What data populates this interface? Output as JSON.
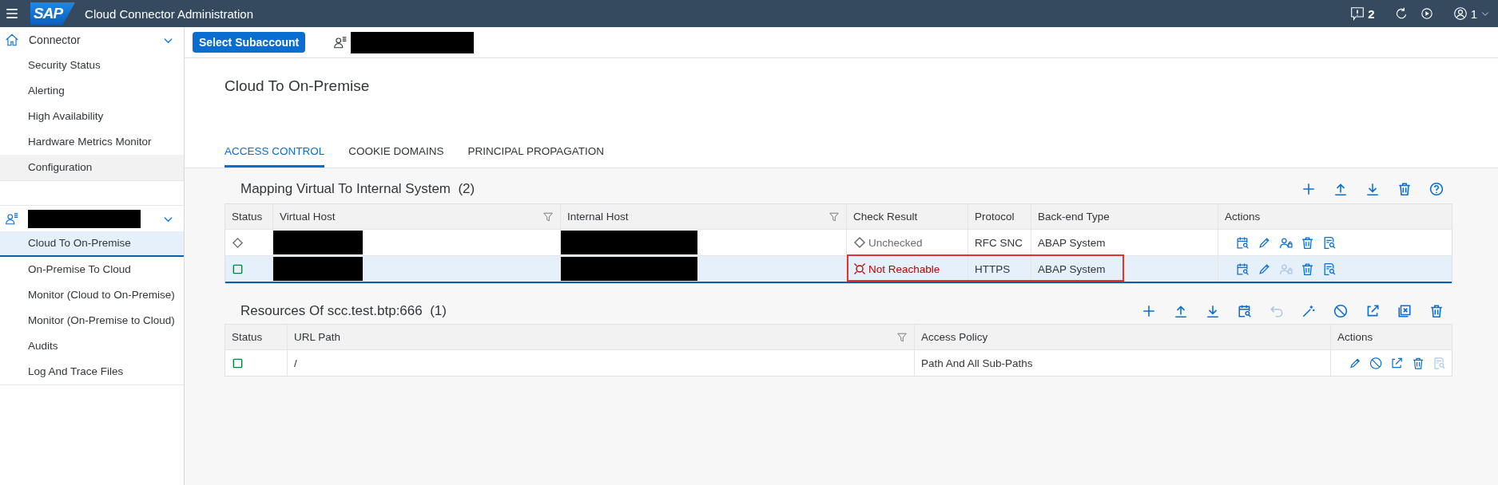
{
  "shell": {
    "logo_text": "SAP",
    "title": "Cloud Connector Administration",
    "notification_count": "2",
    "user_count": "1"
  },
  "sidebar": {
    "groups": [
      {
        "kind": "connector",
        "label": "Connector",
        "expanded": true,
        "items": [
          {
            "label": "Security Status",
            "selected": false,
            "hovered": false
          },
          {
            "label": "Alerting",
            "selected": false,
            "hovered": false
          },
          {
            "label": "High Availability",
            "selected": false,
            "hovered": false
          },
          {
            "label": "Hardware Metrics Monitor",
            "selected": false,
            "hovered": false
          },
          {
            "label": "Configuration",
            "selected": false,
            "hovered": true
          }
        ]
      },
      {
        "kind": "subaccount",
        "expanded": true,
        "items": [
          {
            "label": "Cloud To On-Premise",
            "selected": true,
            "hovered": false
          },
          {
            "label": "On-Premise To Cloud",
            "selected": false,
            "hovered": false
          },
          {
            "label": "Monitor (Cloud to On-Premise)",
            "selected": false,
            "hovered": false
          },
          {
            "label": "Monitor (On-Premise to Cloud)",
            "selected": false,
            "hovered": false
          },
          {
            "label": "Audits",
            "selected": false,
            "hovered": false
          },
          {
            "label": "Log And Trace Files",
            "selected": false,
            "hovered": false
          }
        ]
      }
    ]
  },
  "subheader": {
    "button": "Select Subaccount"
  },
  "page": {
    "title": "Cloud To On-Premise"
  },
  "tabs": [
    {
      "label": "ACCESS CONTROL",
      "selected": true
    },
    {
      "label": "COOKIE DOMAINS",
      "selected": false
    },
    {
      "label": "PRINCIPAL PROPAGATION",
      "selected": false
    }
  ],
  "mapping_table": {
    "title": "Mapping Virtual To Internal System",
    "count": "(2)",
    "toolbar": [
      {
        "kind": "add",
        "disabled": false
      },
      {
        "kind": "upload",
        "disabled": false
      },
      {
        "kind": "download",
        "disabled": false
      },
      {
        "kind": "delete",
        "disabled": false
      },
      {
        "kind": "help",
        "disabled": false
      }
    ],
    "columns": [
      {
        "label": "Status",
        "filter": false
      },
      {
        "label": "Virtual Host",
        "filter": true
      },
      {
        "label": "Internal Host",
        "filter": true
      },
      {
        "label": "Check Result",
        "filter": false
      },
      {
        "label": "Protocol",
        "filter": false
      },
      {
        "label": "Back-end Type",
        "filter": false
      },
      {
        "label": "Actions",
        "filter": false
      }
    ],
    "rows": [
      {
        "status_icon": {
          "kind": "unchecked"
        },
        "selected": false,
        "highlighted": false,
        "check_result": {
          "kind": "unchecked",
          "text": "Unchecked"
        },
        "protocol": "RFC SNC",
        "backend_type": "ABAP System",
        "actions": [
          {
            "kind": "check",
            "disabled": false
          },
          {
            "kind": "edit",
            "disabled": false
          },
          {
            "kind": "principal",
            "disabled": false
          },
          {
            "kind": "delete",
            "disabled": false
          },
          {
            "kind": "logs",
            "disabled": false
          }
        ]
      },
      {
        "status_icon": {
          "kind": "ok"
        },
        "selected": true,
        "highlighted": true,
        "check_result": {
          "kind": "unreachable",
          "text": "Not Reachable"
        },
        "protocol": "HTTPS",
        "backend_type": "ABAP System",
        "actions": [
          {
            "kind": "check",
            "disabled": false
          },
          {
            "kind": "edit",
            "disabled": false
          },
          {
            "kind": "principal",
            "disabled": true
          },
          {
            "kind": "delete",
            "disabled": false
          },
          {
            "kind": "logs",
            "disabled": false
          }
        ]
      }
    ]
  },
  "resources_table": {
    "title": "Resources Of scc.test.btp:666",
    "count": "(1)",
    "toolbar": [
      {
        "kind": "add",
        "disabled": false
      },
      {
        "kind": "upload",
        "disabled": false
      },
      {
        "kind": "download",
        "disabled": false
      },
      {
        "kind": "check",
        "disabled": false
      },
      {
        "kind": "undo",
        "disabled": true
      },
      {
        "kind": "wand",
        "disabled": false
      },
      {
        "kind": "block",
        "disabled": false
      },
      {
        "kind": "open",
        "disabled": false
      },
      {
        "kind": "close",
        "disabled": false
      },
      {
        "kind": "delete",
        "disabled": false
      }
    ],
    "columns": [
      {
        "label": "Status",
        "filter": false
      },
      {
        "label": "URL Path",
        "filter": true
      },
      {
        "label": "Access Policy",
        "filter": false
      },
      {
        "label": "Actions",
        "filter": false
      }
    ],
    "rows": [
      {
        "status_icon": {
          "kind": "ok"
        },
        "url_path": "/",
        "access_policy": "Path And All Sub-Paths",
        "actions": [
          {
            "kind": "edit",
            "disabled": false
          },
          {
            "kind": "block",
            "disabled": false
          },
          {
            "kind": "open",
            "disabled": false
          },
          {
            "kind": "delete",
            "disabled": false
          },
          {
            "kind": "logs",
            "disabled": true
          }
        ]
      }
    ]
  }
}
